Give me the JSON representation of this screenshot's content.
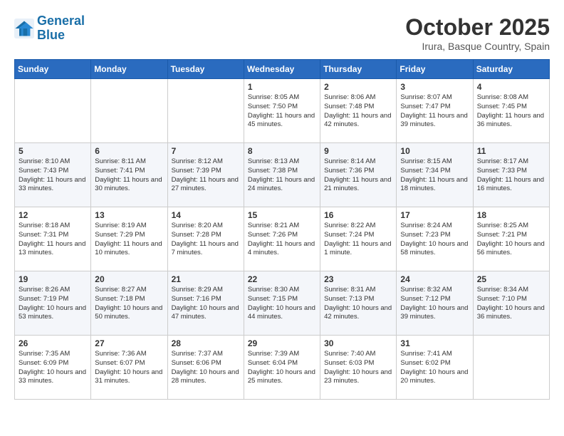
{
  "header": {
    "logo_line1": "General",
    "logo_line2": "Blue",
    "title": "October 2025",
    "subtitle": "Irura, Basque Country, Spain"
  },
  "weekdays": [
    "Sunday",
    "Monday",
    "Tuesday",
    "Wednesday",
    "Thursday",
    "Friday",
    "Saturday"
  ],
  "weeks": [
    [
      {
        "day": "",
        "content": ""
      },
      {
        "day": "",
        "content": ""
      },
      {
        "day": "",
        "content": ""
      },
      {
        "day": "1",
        "content": "Sunrise: 8:05 AM\nSunset: 7:50 PM\nDaylight: 11 hours and 45 minutes."
      },
      {
        "day": "2",
        "content": "Sunrise: 8:06 AM\nSunset: 7:48 PM\nDaylight: 11 hours and 42 minutes."
      },
      {
        "day": "3",
        "content": "Sunrise: 8:07 AM\nSunset: 7:47 PM\nDaylight: 11 hours and 39 minutes."
      },
      {
        "day": "4",
        "content": "Sunrise: 8:08 AM\nSunset: 7:45 PM\nDaylight: 11 hours and 36 minutes."
      }
    ],
    [
      {
        "day": "5",
        "content": "Sunrise: 8:10 AM\nSunset: 7:43 PM\nDaylight: 11 hours and 33 minutes."
      },
      {
        "day": "6",
        "content": "Sunrise: 8:11 AM\nSunset: 7:41 PM\nDaylight: 11 hours and 30 minutes."
      },
      {
        "day": "7",
        "content": "Sunrise: 8:12 AM\nSunset: 7:39 PM\nDaylight: 11 hours and 27 minutes."
      },
      {
        "day": "8",
        "content": "Sunrise: 8:13 AM\nSunset: 7:38 PM\nDaylight: 11 hours and 24 minutes."
      },
      {
        "day": "9",
        "content": "Sunrise: 8:14 AM\nSunset: 7:36 PM\nDaylight: 11 hours and 21 minutes."
      },
      {
        "day": "10",
        "content": "Sunrise: 8:15 AM\nSunset: 7:34 PM\nDaylight: 11 hours and 18 minutes."
      },
      {
        "day": "11",
        "content": "Sunrise: 8:17 AM\nSunset: 7:33 PM\nDaylight: 11 hours and 16 minutes."
      }
    ],
    [
      {
        "day": "12",
        "content": "Sunrise: 8:18 AM\nSunset: 7:31 PM\nDaylight: 11 hours and 13 minutes."
      },
      {
        "day": "13",
        "content": "Sunrise: 8:19 AM\nSunset: 7:29 PM\nDaylight: 11 hours and 10 minutes."
      },
      {
        "day": "14",
        "content": "Sunrise: 8:20 AM\nSunset: 7:28 PM\nDaylight: 11 hours and 7 minutes."
      },
      {
        "day": "15",
        "content": "Sunrise: 8:21 AM\nSunset: 7:26 PM\nDaylight: 11 hours and 4 minutes."
      },
      {
        "day": "16",
        "content": "Sunrise: 8:22 AM\nSunset: 7:24 PM\nDaylight: 11 hours and 1 minute."
      },
      {
        "day": "17",
        "content": "Sunrise: 8:24 AM\nSunset: 7:23 PM\nDaylight: 10 hours and 58 minutes."
      },
      {
        "day": "18",
        "content": "Sunrise: 8:25 AM\nSunset: 7:21 PM\nDaylight: 10 hours and 56 minutes."
      }
    ],
    [
      {
        "day": "19",
        "content": "Sunrise: 8:26 AM\nSunset: 7:19 PM\nDaylight: 10 hours and 53 minutes."
      },
      {
        "day": "20",
        "content": "Sunrise: 8:27 AM\nSunset: 7:18 PM\nDaylight: 10 hours and 50 minutes."
      },
      {
        "day": "21",
        "content": "Sunrise: 8:29 AM\nSunset: 7:16 PM\nDaylight: 10 hours and 47 minutes."
      },
      {
        "day": "22",
        "content": "Sunrise: 8:30 AM\nSunset: 7:15 PM\nDaylight: 10 hours and 44 minutes."
      },
      {
        "day": "23",
        "content": "Sunrise: 8:31 AM\nSunset: 7:13 PM\nDaylight: 10 hours and 42 minutes."
      },
      {
        "day": "24",
        "content": "Sunrise: 8:32 AM\nSunset: 7:12 PM\nDaylight: 10 hours and 39 minutes."
      },
      {
        "day": "25",
        "content": "Sunrise: 8:34 AM\nSunset: 7:10 PM\nDaylight: 10 hours and 36 minutes."
      }
    ],
    [
      {
        "day": "26",
        "content": "Sunrise: 7:35 AM\nSunset: 6:09 PM\nDaylight: 10 hours and 33 minutes."
      },
      {
        "day": "27",
        "content": "Sunrise: 7:36 AM\nSunset: 6:07 PM\nDaylight: 10 hours and 31 minutes."
      },
      {
        "day": "28",
        "content": "Sunrise: 7:37 AM\nSunset: 6:06 PM\nDaylight: 10 hours and 28 minutes."
      },
      {
        "day": "29",
        "content": "Sunrise: 7:39 AM\nSunset: 6:04 PM\nDaylight: 10 hours and 25 minutes."
      },
      {
        "day": "30",
        "content": "Sunrise: 7:40 AM\nSunset: 6:03 PM\nDaylight: 10 hours and 23 minutes."
      },
      {
        "day": "31",
        "content": "Sunrise: 7:41 AM\nSunset: 6:02 PM\nDaylight: 10 hours and 20 minutes."
      },
      {
        "day": "",
        "content": ""
      }
    ]
  ]
}
